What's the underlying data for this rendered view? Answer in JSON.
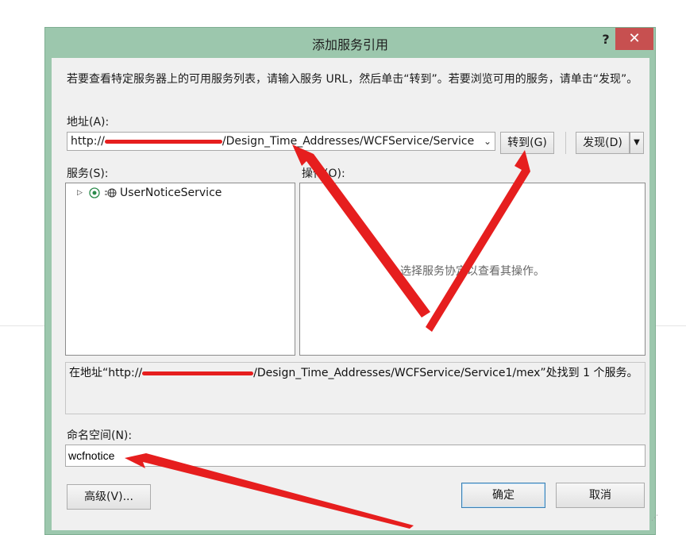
{
  "dialog": {
    "title": "添加服务引用",
    "help_glyph": "?",
    "close_glyph": "✕",
    "instructions": "若要查看特定服务器上的可用服务列表，请输入服务 URL，然后单击“转到”。若要浏览可用的服务，请单击“发现”。",
    "address": {
      "label": "地址(A):",
      "value_prefix": "http://",
      "value_suffix": "/Design_Time_Addresses/WCFService/Service"
    },
    "go_button": "转到(G)",
    "discover_button": "发现(D)",
    "services": {
      "label": "服务(S):",
      "items": [
        {
          "label": "UserNoticeService"
        }
      ]
    },
    "operations": {
      "label": "操作(O):",
      "placeholder": "选择服务协定以查看其操作。"
    },
    "status": {
      "prefix": "在地址“http://",
      "suffix": "/Design_Time_Addresses/WCFService/Service1/mex”处找到 1 个服务。"
    },
    "namespace": {
      "label": "命名空间(N):",
      "value": "wcfnotice"
    },
    "advanced_button": "高级(V)...",
    "ok_button": "确定",
    "cancel_button": "取消"
  },
  "colors": {
    "window_frame": "#9cc7ad",
    "close_button": "#c75050",
    "annotation_arrow": "#e61e1e"
  }
}
